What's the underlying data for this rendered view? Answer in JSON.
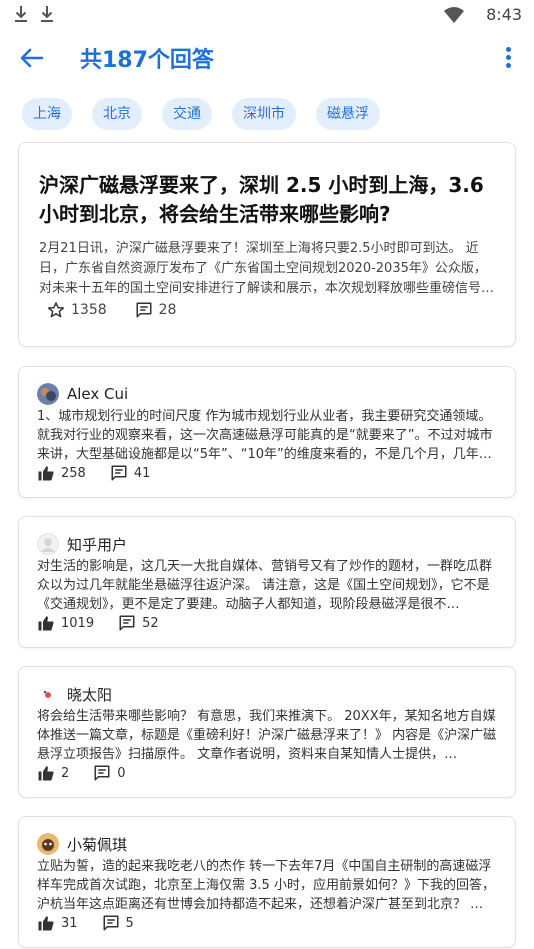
{
  "status": {
    "time": "8:43"
  },
  "header": {
    "title": "共187个回答"
  },
  "tags": [
    "上海",
    "北京",
    "交通",
    "深圳市",
    "磁悬浮"
  ],
  "question": {
    "title": "沪深广磁悬浮要来了，深圳 2.5 小时到上海，3.6 小时到北京，将会给生活带来哪些影响?",
    "excerpt": "2月21日讯，沪深广磁悬浮要来了！深圳至上海将只要2.5小时即可到达。 近日，广东省自然资源厅发布了《广东省国土空间规划2020-2035年》公众版，对未来十五年的国土空间安排进行了解读和展示，本次规划释放哪些重磅信号…",
    "stars": "1358",
    "comments": "28"
  },
  "answers": [
    {
      "author": "Alex Cui",
      "text": "1、城市规划行业的时间尺度 作为城市规划行业从业者，我主要研究交通领域。就我对行业的观察来看，这一次高速磁悬浮可能真的是“就要来了”。不过对城市来讲，大型基础设施都是以“5年”、“10年”的维度来看的，不是几个月，几年…",
      "likes": "258",
      "comments": "41"
    },
    {
      "author": "知乎用户",
      "text": "对生活的影响是，这几天一大批自媒体、营销号又有了炒作的题材，一群吃瓜群众以为过几年就能坐悬磁浮往返沪深。 请注意，这是《国土空间规划》，它不是《交通规划》，更不是定了要建。动脑子人都知道，现阶段悬磁浮是很不…",
      "likes": "1019",
      "comments": "52"
    },
    {
      "author": "晓太阳",
      "text": "将会给生活带来哪些影响？ 有意思，我们来推演下。 20XX年，某知名地方自媒体推送一篇文章，标题是《重磅利好！沪深广磁悬浮来了！》 内容是《沪深广磁悬浮立项报告》扫描原件。 文章作者说明，资料来自某知情人士提供，…",
      "likes": "2",
      "comments": "0"
    },
    {
      "author": "小菊佩琪",
      "text": "立贴为誓，造的起来我吃老八的杰作 转一下去年7月《中国自主研制的高速磁浮样车完成首次试跑，北京至上海仅需 3.5 小时，应用前景如何？》下我的回答，沪杭当年这点距离还有世博会加持都造不起来，还想着沪深广甚至到北京？ …",
      "likes": "31",
      "comments": "5"
    }
  ],
  "icons": {
    "back": "arrow-left-icon",
    "more": "more-vert-icon",
    "star": "star-icon",
    "comment": "comment-icon",
    "like": "thumb-up-icon",
    "wifi": "wifi-icon",
    "download": "download-icon"
  },
  "colors": {
    "accent": "#1e6fd9",
    "tag_bg": "#e3eefc"
  }
}
